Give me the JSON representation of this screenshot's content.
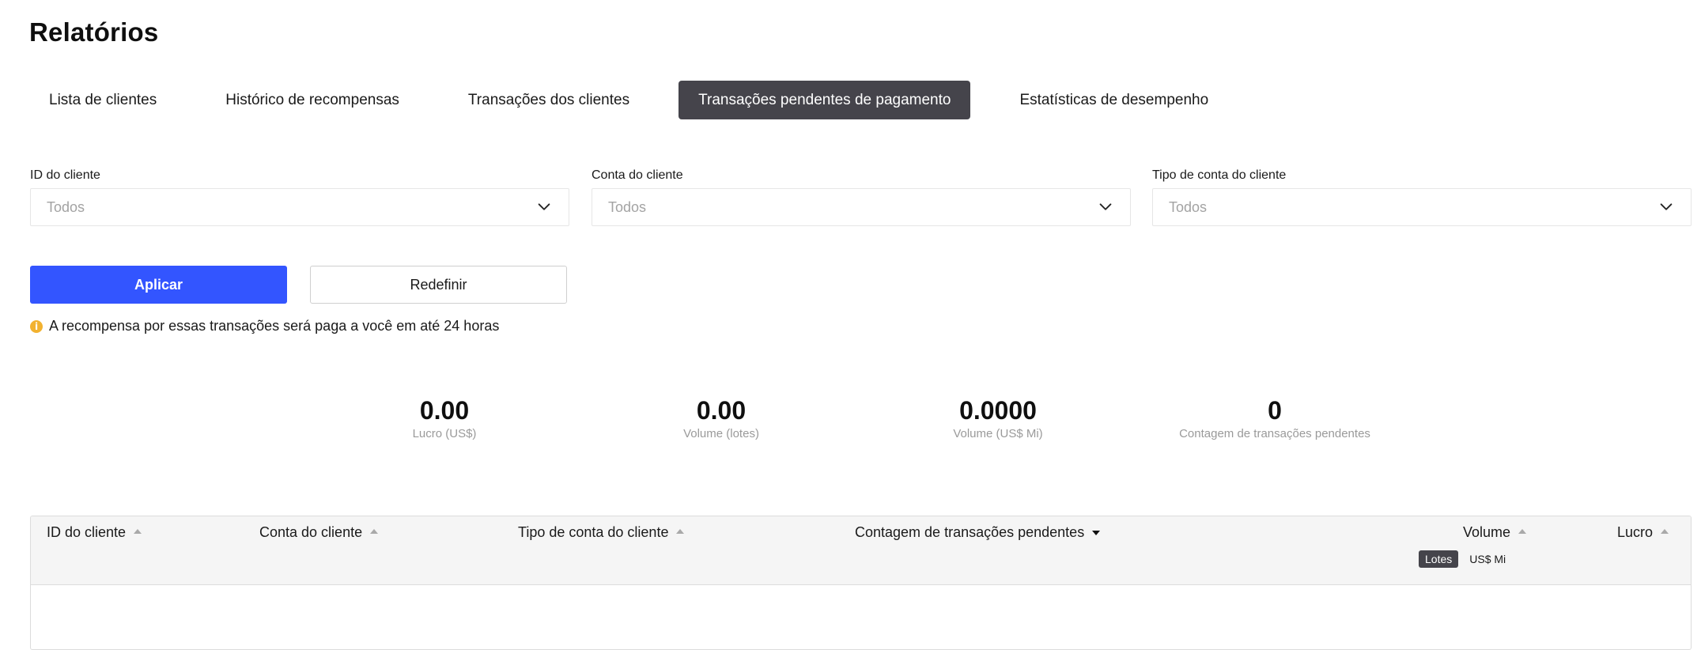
{
  "page": {
    "title": "Relatórios"
  },
  "tabs": [
    {
      "label": "Lista de clientes",
      "active": false
    },
    {
      "label": "Histórico de recompensas",
      "active": false
    },
    {
      "label": "Transações dos clientes",
      "active": false
    },
    {
      "label": "Transações pendentes de pagamento",
      "active": true
    },
    {
      "label": "Estatísticas de desempenho",
      "active": false
    }
  ],
  "filters": [
    {
      "label": "ID do cliente",
      "value": "Todos",
      "icon": "chevron-down-icon"
    },
    {
      "label": "Conta do cliente",
      "value": "Todos",
      "icon": "chevron-down-icon"
    },
    {
      "label": "Tipo de conta do cliente",
      "value": "Todos",
      "icon": "chevron-down-icon"
    }
  ],
  "actions": {
    "apply_label": "Aplicar",
    "reset_label": "Redefinir"
  },
  "notice": {
    "icon": "info-icon",
    "icon_glyph": "i",
    "text": "A recompensa por essas transações será paga a você em até 24 horas"
  },
  "stats": [
    {
      "value": "0.00",
      "label": "Lucro (US$)"
    },
    {
      "value": "0.00",
      "label": "Volume (lotes)"
    },
    {
      "value": "0.0000",
      "label": "Volume (US$ Mi)"
    },
    {
      "value": "0",
      "label": "Contagem de transações pendentes"
    }
  ],
  "table": {
    "columns": [
      {
        "label": "ID do cliente",
        "sort": "asc"
      },
      {
        "label": "Conta do cliente",
        "sort": "asc"
      },
      {
        "label": "Tipo de conta do cliente",
        "sort": "asc"
      },
      {
        "label": "Contagem de transações pendentes",
        "sort": "desc"
      },
      {
        "label": "Volume",
        "sort": "asc"
      },
      {
        "label": "Lucro",
        "sort": "asc"
      }
    ],
    "volume_units": [
      {
        "label": "Lotes",
        "active": true
      },
      {
        "label": "US$ Mi",
        "active": false
      }
    ],
    "rows": []
  },
  "colors": {
    "accent": "#3355ff",
    "active_tab": "#45444b",
    "info": "#f2b230"
  }
}
